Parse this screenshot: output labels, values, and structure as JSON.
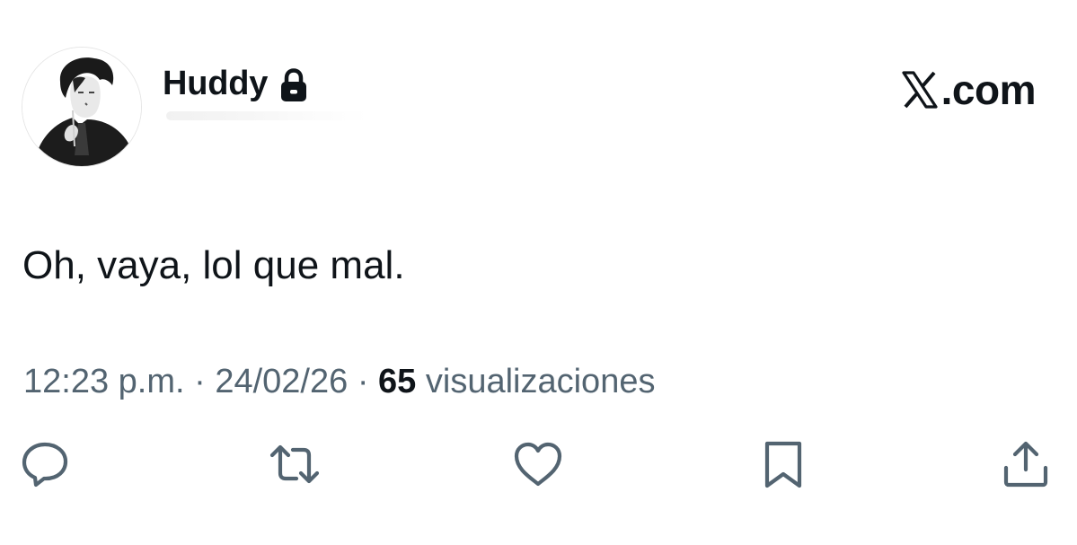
{
  "author": {
    "display_name": "Huddy",
    "protected_icon": "lock-icon",
    "avatar_icon": "profile-photo"
  },
  "brand": {
    "text": ".com",
    "logo_icon": "x-logo-icon"
  },
  "tweet": {
    "text": "Oh, vaya, lol que mal.",
    "time": "12:23 p.m.",
    "separator": "·",
    "date": "24/02/26",
    "views_count": "65",
    "views_label": "visualizaciones"
  },
  "actions": [
    {
      "icon": "reply-icon"
    },
    {
      "icon": "retweet-icon"
    },
    {
      "icon": "like-icon"
    },
    {
      "icon": "bookmark-icon"
    },
    {
      "icon": "share-icon"
    }
  ],
  "colors": {
    "text_primary": "#0f1419",
    "text_secondary": "#536471",
    "icon": "#536471",
    "background": "#ffffff"
  }
}
